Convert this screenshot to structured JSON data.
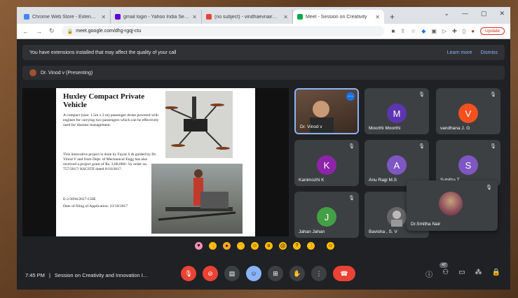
{
  "browser": {
    "tabs": [
      {
        "label": "Chrome Web Store - Extensions",
        "color": "#4285f4"
      },
      {
        "label": "gmail login - Yahoo India Search",
        "color": "#6001d2"
      },
      {
        "label": "(no subject) - vindhaevnair@gm",
        "color": "#ea4335"
      },
      {
        "label": "Meet - Session on Creativity",
        "color": "#00ac47"
      }
    ],
    "url": "meet.google.com/dhg-rgqj-ctu",
    "update_label": "Update"
  },
  "banner": {
    "message": "You have extensions installed that may affect the quality of your call",
    "learn_more": "Learn more",
    "dismiss": "Dismiss"
  },
  "presenter": {
    "label": "Dr. Vinod v (Presenting)"
  },
  "slide": {
    "title": "Huxley Compact Private Vehicle",
    "para1": "A compact (size: 1.5m x 2 m) passenger drone powered with engines for carrying two passengers which can be effectively used for disaster management.",
    "para2": "This innovative project is done by Fayaz S & guided by Dr. Vinod V and from Dept. of Mechanical Engg has also received a project grant of Rs. 3,80,000/- by order no. 757/2017/ KSCSTE dated 8/10/2017.",
    "para3": "E-2/3094/2017-CHE",
    "para4": "Date of filing of Application: 23/10/2017"
  },
  "tiles": [
    {
      "name": "Dr. Vinod v",
      "initial": "",
      "color": ""
    },
    {
      "name": "Moorthi Moorthi",
      "initial": "M",
      "color": "#5e35b1"
    },
    {
      "name": "vandhana J. G",
      "initial": "V",
      "color": "#f4511e"
    },
    {
      "name": "Kanimozhi K",
      "initial": "K",
      "color": "#8e24aa"
    },
    {
      "name": "Anu Ragi M.S",
      "initial": "A",
      "color": "#7e57c2"
    },
    {
      "name": "Subitha T",
      "initial": "S",
      "color": "#7e57c2"
    },
    {
      "name": "Jahan Jahan",
      "initial": "J",
      "color": "#43a047"
    },
    {
      "name": "Bavisha , S. V",
      "initial": "",
      "color": ""
    }
  ],
  "floating": {
    "name": "Dr.Smitha Nair"
  },
  "bottom": {
    "time": "7:45 PM",
    "separator": "|",
    "meeting_title": "Session on Creativity and Innovation I...",
    "participant_count": "47"
  },
  "icons": {
    "reactions": [
      "sparkling-heart-icon",
      "thumbs-up-icon",
      "party-popper-icon",
      "clapping-hands-icon",
      "laughing-face-icon",
      "surprised-face-icon",
      "crying-face-icon",
      "thinking-face-icon",
      "thumbs-down-icon",
      "smile-icon"
    ]
  }
}
